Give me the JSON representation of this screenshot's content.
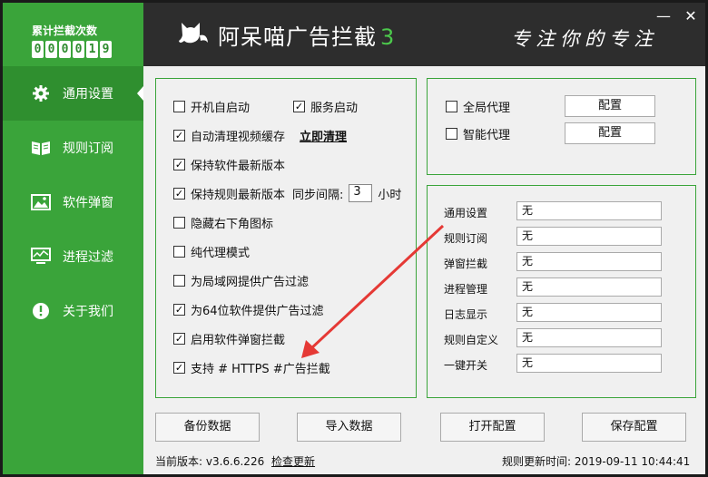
{
  "sidebar": {
    "counter_label": "累计拦截次数",
    "counter_digits": [
      "0",
      "0",
      "0",
      "0",
      "1",
      "9"
    ],
    "items": [
      {
        "label": "通用设置",
        "icon": "gear-icon",
        "active": true
      },
      {
        "label": "规则订阅",
        "icon": "book-icon"
      },
      {
        "label": "软件弹窗",
        "icon": "picture-icon"
      },
      {
        "label": "进程过滤",
        "icon": "monitor-icon"
      },
      {
        "label": "关于我们",
        "icon": "info-icon"
      }
    ]
  },
  "header": {
    "title": "阿呆喵广告拦截",
    "version": "3",
    "slogan": "专注你的专注",
    "minimize": "—",
    "close": "✕"
  },
  "options": {
    "boot_start": {
      "label": "开机自启动",
      "checked": false
    },
    "service_start": {
      "label": "服务启动",
      "checked": true
    },
    "auto_clean": {
      "label": "自动清理视频缓存",
      "checked": true
    },
    "clean_now": "立即清理",
    "keep_software": {
      "label": "保持软件最新版本",
      "checked": true
    },
    "keep_rules": {
      "label": "保持规则最新版本",
      "checked": true
    },
    "sync_interval_label": "同步间隔:",
    "sync_interval_value": "3",
    "sync_interval_unit": "小时",
    "hide_tray": {
      "label": "隐藏右下角图标",
      "checked": false
    },
    "pure_proxy": {
      "label": "纯代理模式",
      "checked": false
    },
    "lan_filter": {
      "label": "为局域网提供广告过滤",
      "checked": false
    },
    "x64_filter": {
      "label": "为64位软件提供广告过滤",
      "checked": true
    },
    "popup_block": {
      "label": "启用软件弹窗拦截",
      "checked": true
    },
    "https": {
      "label": "支持 # HTTPS #广告拦截",
      "checked": true
    }
  },
  "proxy": {
    "global": {
      "label": "全局代理",
      "checked": false,
      "button": "配置"
    },
    "smart": {
      "label": "智能代理",
      "checked": false,
      "button": "配置"
    }
  },
  "hotkeys": [
    {
      "label": "通用设置",
      "value": "无"
    },
    {
      "label": "规则订阅",
      "value": "无"
    },
    {
      "label": "弹窗拦截",
      "value": "无"
    },
    {
      "label": "进程管理",
      "value": "无"
    },
    {
      "label": "日志显示",
      "value": "无"
    },
    {
      "label": "规则自定义",
      "value": "无"
    },
    {
      "label": "一键开关",
      "value": "无"
    }
  ],
  "buttons": {
    "backup": "备份数据",
    "import": "导入数据",
    "open_config": "打开配置",
    "save_config": "保存配置"
  },
  "footer": {
    "version_label": "当前版本: v3.6.6.226",
    "check_update": "检查更新",
    "rule_update": "规则更新时间: 2019-09-11 10:44:41"
  },
  "colors": {
    "accent": "#3aa43a",
    "accent_dark": "#2f8f2f",
    "header_bg": "#2d2d2d",
    "arrow": "#e53935"
  }
}
